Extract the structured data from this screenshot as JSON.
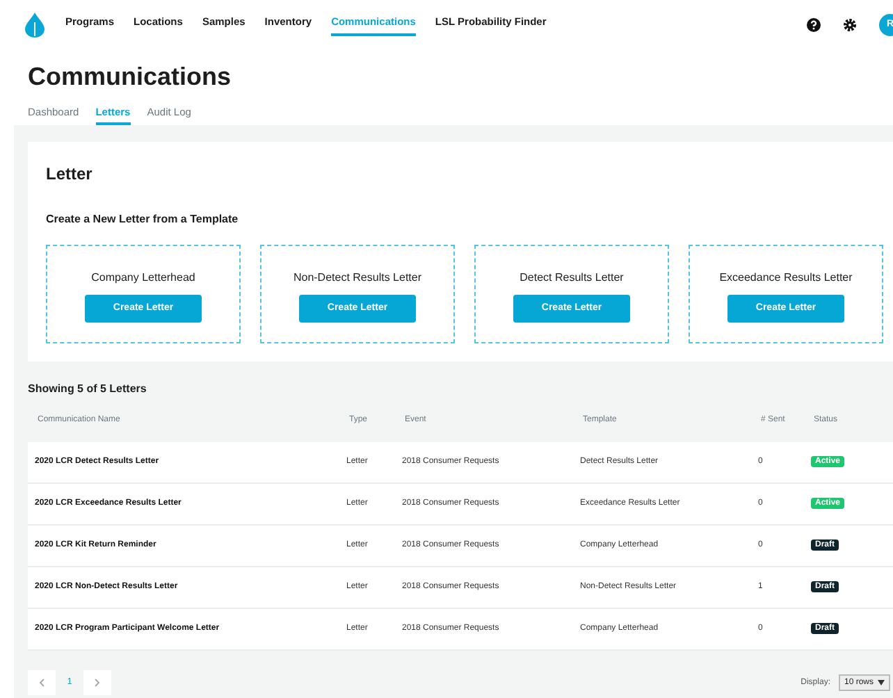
{
  "nav": {
    "items": [
      {
        "label": "Programs",
        "selected": false
      },
      {
        "label": "Locations",
        "selected": false
      },
      {
        "label": "Samples",
        "selected": false
      },
      {
        "label": "Inventory",
        "selected": false
      },
      {
        "label": "Communications",
        "selected": true
      },
      {
        "label": "LSL Probability Finder",
        "selected": false
      }
    ],
    "avatar": "R"
  },
  "page_title": "Communications",
  "tabs": [
    {
      "label": "Dashboard",
      "selected": false
    },
    {
      "label": "Letters",
      "selected": true
    },
    {
      "label": "Audit Log",
      "selected": false
    }
  ],
  "letter_card": {
    "title": "Letter",
    "subtitle": "Create a New Letter from a Template",
    "templates": [
      {
        "name": "Company Letterhead",
        "button": "Create Letter"
      },
      {
        "name": "Non-Detect Results Letter",
        "button": "Create Letter"
      },
      {
        "name": "Detect Results Letter",
        "button": "Create Letter"
      },
      {
        "name": "Exceedance Results Letter",
        "button": "Create Letter"
      }
    ]
  },
  "table": {
    "summary": "Showing 5 of 5 Letters",
    "columns": [
      "Communication Name",
      "Type",
      "Event",
      "Template",
      "# Sent",
      "Status"
    ],
    "rows": [
      {
        "name": "2020 LCR Detect Results Letter",
        "type": "Letter",
        "event": "2018 Consumer Requests",
        "template": "Detect Results Letter",
        "sent": "0",
        "status": {
          "label": "Active",
          "kind": "active"
        }
      },
      {
        "name": "2020 LCR Exceedance Results Letter",
        "type": "Letter",
        "event": "2018 Consumer Requests",
        "template": "Exceedance Results Letter",
        "sent": "0",
        "status": {
          "label": "Active",
          "kind": "active"
        }
      },
      {
        "name": "2020 LCR Kit Return Reminder",
        "type": "Letter",
        "event": "2018 Consumer Requests",
        "template": "Company Letterhead",
        "sent": "0",
        "status": {
          "label": "Draft",
          "kind": "draft"
        }
      },
      {
        "name": "2020 LCR Non-Detect Results Letter",
        "type": "Letter",
        "event": "2018 Consumer Requests",
        "template": "Non-Detect Results Letter",
        "sent": "1",
        "status": {
          "label": "Draft",
          "kind": "draft"
        }
      },
      {
        "name": "2020 LCR Program Participant Welcome Letter",
        "type": "Letter",
        "event": "2018 Consumer Requests",
        "template": "Company Letterhead",
        "sent": "0",
        "status": {
          "label": "Draft",
          "kind": "draft"
        }
      }
    ]
  },
  "pagination": {
    "pages": [
      {
        "label": "1",
        "selected": true
      }
    ],
    "display_label": "Display:",
    "display_value": "10 rows"
  }
}
